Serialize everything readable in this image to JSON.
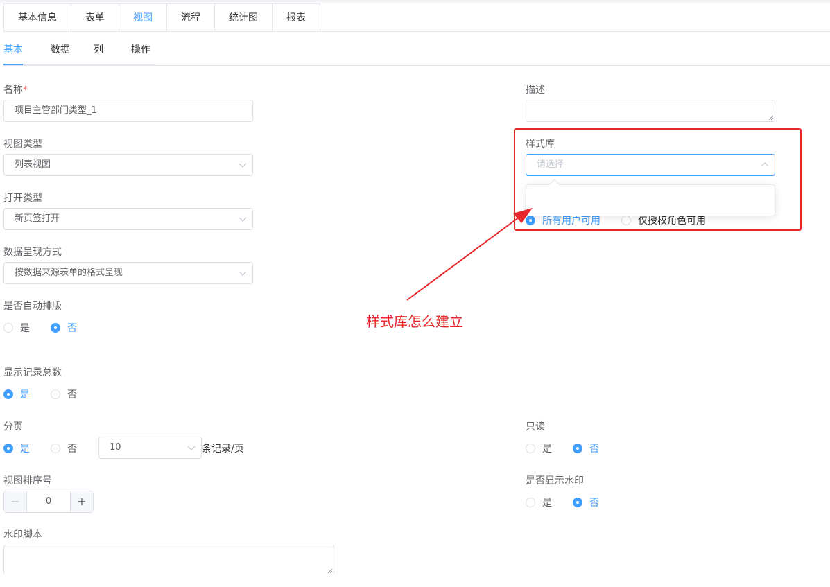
{
  "top_tabs": [
    "基本信息",
    "表单",
    "视图",
    "流程",
    "统计图",
    "报表"
  ],
  "top_tab_active": "视图",
  "sub_tabs": [
    "基本",
    "数据",
    "列",
    "操作"
  ],
  "form": {
    "name_label": "名称",
    "name_required": "*",
    "name_value": "项目主管部门类型_1",
    "desc_label": "描述",
    "desc_value": "",
    "view_type_label": "视图类型",
    "view_type_value": "列表视图",
    "style_lib_label": "样式库",
    "style_lib_placeholder": "请选择",
    "open_type_label": "打开类型",
    "open_type_value": "新页签打开",
    "permission_options": [
      "所有用户可用",
      "仅授权角色可用"
    ],
    "data_display_label": "数据呈现方式",
    "data_display_value": "按数据来源表单的格式呈现",
    "auto_layout_label": "是否自动排版",
    "show_total_label": "显示记录总数",
    "paging_label": "分页",
    "page_size_value": "10",
    "page_size_suffix": "条记录/页",
    "readonly_label": "只读",
    "sort_label": "视图排序号",
    "sort_value": "0",
    "sort_minus": "−",
    "sort_plus": "+",
    "watermark_show_label": "是否显示水印",
    "watermark_script_label": "水印脚本",
    "yes": "是",
    "no": "否"
  },
  "radios": {
    "auto_layout": "否",
    "show_total": "是",
    "paging": "是",
    "readonly": "否",
    "watermark_show": "否",
    "permission": "所有用户可用"
  },
  "annotation": {
    "text": "样式库怎么建立",
    "color": "#e8262a"
  },
  "colors": {
    "accent": "#409eff",
    "required": "#f56c6c",
    "annotation": "#e8262a"
  }
}
